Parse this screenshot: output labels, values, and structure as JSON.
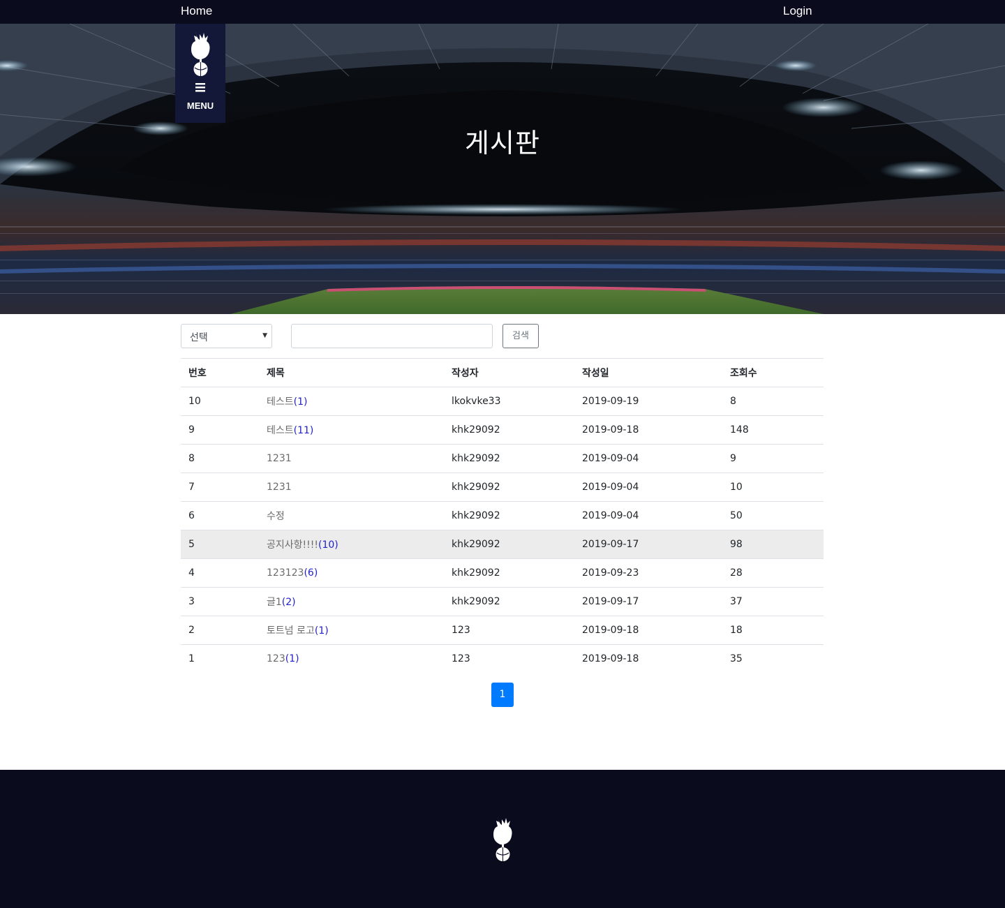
{
  "nav": {
    "home": "Home",
    "login": "Login"
  },
  "menu": {
    "label": "MENU"
  },
  "hero": {
    "title": "게시판"
  },
  "search": {
    "select_value": "선택",
    "input_value": "",
    "button_label": "검색"
  },
  "table": {
    "headers": [
      "번호",
      "제목",
      "작성자",
      "작성일",
      "조회수"
    ],
    "rows": [
      {
        "no": "10",
        "title": "테스트",
        "comments": "(1)",
        "writer": "lkokvke33",
        "date": "2019-09-19",
        "views": "8"
      },
      {
        "no": "9",
        "title": "테스트",
        "comments": "(11)",
        "writer": "khk29092",
        "date": "2019-09-18",
        "views": "148"
      },
      {
        "no": "8",
        "title": "1231",
        "comments": "",
        "writer": "khk29092",
        "date": "2019-09-04",
        "views": "9"
      },
      {
        "no": "7",
        "title": "1231",
        "comments": "",
        "writer": "khk29092",
        "date": "2019-09-04",
        "views": "10"
      },
      {
        "no": "6",
        "title": "수정",
        "comments": "",
        "writer": "khk29092",
        "date": "2019-09-04",
        "views": "50"
      },
      {
        "no": "5",
        "title": "공지사항!!!!",
        "comments": "(10)",
        "writer": "khk29092",
        "date": "2019-09-17",
        "views": "98"
      },
      {
        "no": "4",
        "title": "123123",
        "comments": "(6)",
        "writer": "khk29092",
        "date": "2019-09-23",
        "views": "28"
      },
      {
        "no": "3",
        "title": "글1",
        "comments": "(2)",
        "writer": "khk29092",
        "date": "2019-09-17",
        "views": "37"
      },
      {
        "no": "2",
        "title": "토트넘 로고",
        "comments": "(1)",
        "writer": "123",
        "date": "2019-09-18",
        "views": "18"
      },
      {
        "no": "1",
        "title": "123",
        "comments": "(1)",
        "writer": "123",
        "date": "2019-09-18",
        "views": "35"
      }
    ]
  },
  "pagination": {
    "current": "1"
  },
  "colors": {
    "nav_bg": "#0a0c1e",
    "menu_bg": "#131838",
    "page_active": "#007bff",
    "comment_link": "#2222cc"
  },
  "icons": {
    "logo": "cockerel-logo-icon",
    "menu": "hamburger-icon",
    "select": "caret-down-icon"
  }
}
